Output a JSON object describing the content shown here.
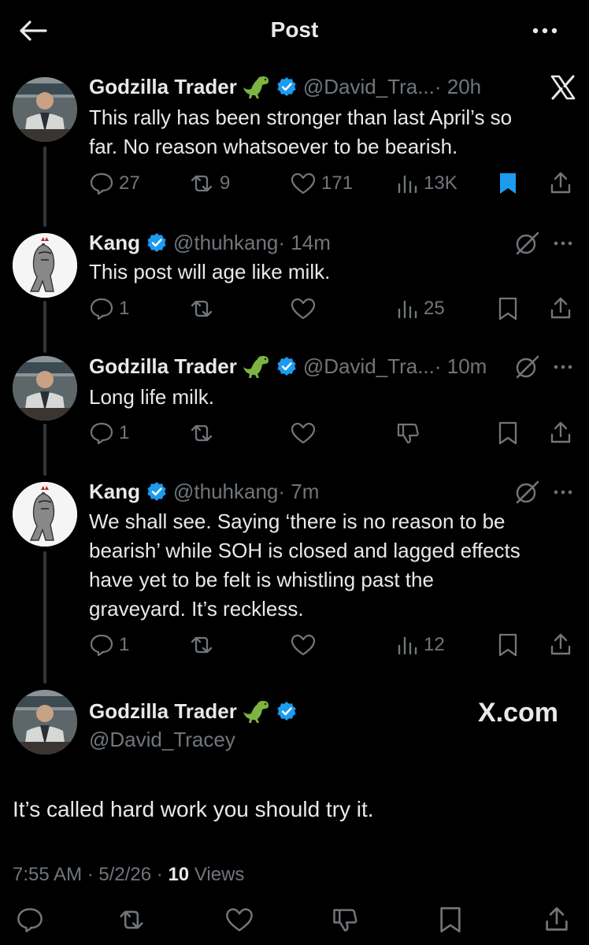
{
  "topbar": {
    "title": "Post"
  },
  "replies": [
    {
      "name": "Godzilla Trader",
      "handle": "@David_Tra...",
      "time": "· 20h",
      "lines": [
        "This rally has been stronger than last April’s so",
        "far. No reason whatsoever to be bearish."
      ],
      "stats": {
        "replies": "27",
        "reposts": "9",
        "likes": "171",
        "views": "13K"
      }
    },
    {
      "name": "Kang",
      "handle": "@thuhkang",
      "time": "· 14m",
      "lines": [
        "This post will age like milk."
      ],
      "stats": {
        "replies": "1",
        "views": "25"
      }
    },
    {
      "name": "Godzilla Trader",
      "handle": "@David_Tra...",
      "time": "· 10m",
      "lines": [
        "Long life milk."
      ],
      "stats": {
        "replies": "1"
      }
    },
    {
      "name": "Kang",
      "handle": "@thuhkang",
      "time": "· 7m",
      "lines": [
        "We shall see. Saying ‘there is no reason to be",
        "bearish’ while SOH is closed and lagged effects",
        "have yet to be felt is whistling past the",
        "graveyard. It’s reckless."
      ],
      "stats": {
        "replies": "1",
        "views": "12"
      }
    }
  ],
  "main_post": {
    "name": "Godzilla Trader",
    "handle": "@David_Tracey",
    "watermark": "X.com",
    "text": "It’s called hard work you should try it.",
    "timestamp": "7:55 AM · 5/2/26 ·",
    "views_count": "10",
    "views_label": "Views"
  },
  "colors": {
    "background": "#000000",
    "text": "#e7e9ea",
    "muted": "#71767b",
    "accent": "#1d9bf0",
    "dino": "#7cb342"
  }
}
